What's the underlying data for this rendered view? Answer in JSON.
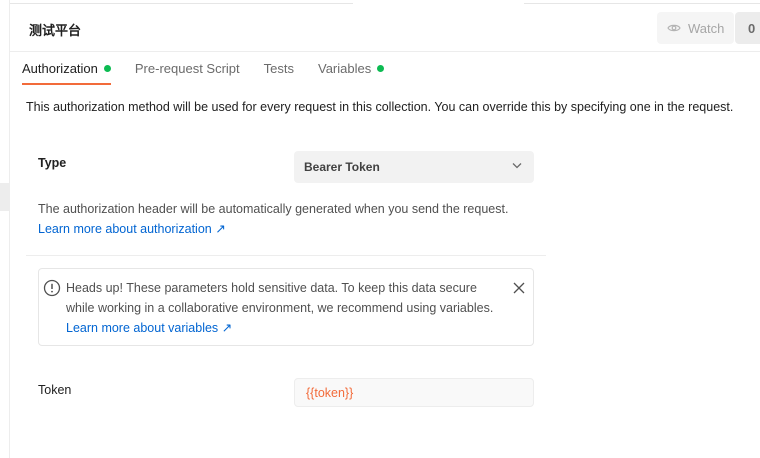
{
  "collection": {
    "title": "测试平台"
  },
  "watch": {
    "label": "Watch",
    "count": "0"
  },
  "tabs": [
    {
      "label": "Authorization",
      "active": true,
      "has_dot": true
    },
    {
      "label": "Pre-request Script",
      "active": false,
      "has_dot": false
    },
    {
      "label": "Tests",
      "active": false,
      "has_dot": false
    },
    {
      "label": "Variables",
      "active": false,
      "has_dot": true
    }
  ],
  "auth": {
    "description": "This authorization method will be used for every request in this collection. You can override this by specifying one in the request.",
    "type_label": "Type",
    "type_value": "Bearer Token",
    "note": "The authorization header will be automatically generated when you send the request.",
    "learn_more": "Learn more about authorization ↗",
    "token_label": "Token",
    "token_value": "{{token}}"
  },
  "alert": {
    "text": "Heads up! These parameters hold sensitive data. To keep this data secure while working in a collaborative environment, we recommend using variables.",
    "link": "Learn more about variables ↗",
    "icon": "info-circle-icon"
  },
  "colors": {
    "accent": "#f26b3a",
    "link": "#0265d2",
    "dot": "#0cbb52"
  }
}
